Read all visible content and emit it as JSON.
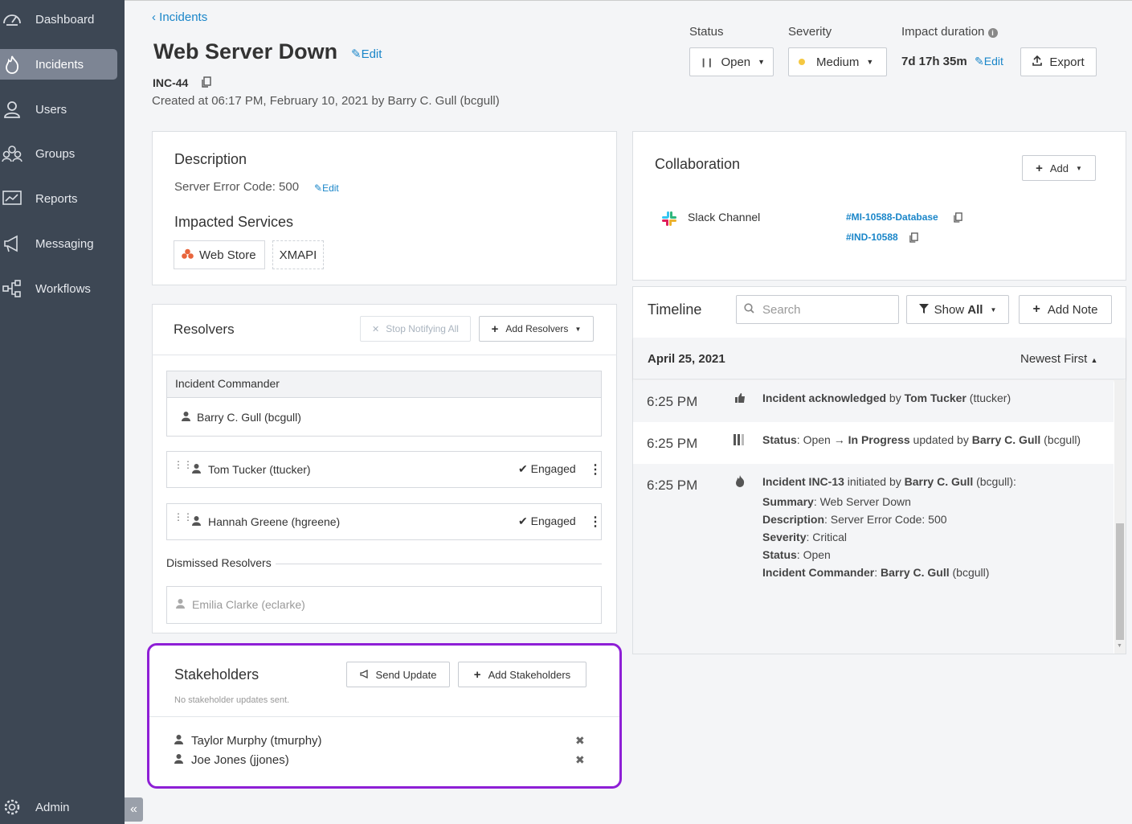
{
  "sidebar": {
    "items": [
      {
        "label": "Dashboard",
        "icon": "gauge-icon"
      },
      {
        "label": "Incidents",
        "icon": "flame-icon"
      },
      {
        "label": "Users",
        "icon": "user-icon"
      },
      {
        "label": "Groups",
        "icon": "groups-icon"
      },
      {
        "label": "Reports",
        "icon": "chart-icon"
      },
      {
        "label": "Messaging",
        "icon": "megaphone-icon"
      },
      {
        "label": "Workflows",
        "icon": "workflow-icon"
      }
    ],
    "admin_label": "Admin",
    "collapse_glyph": "«"
  },
  "header": {
    "breadcrumb": "‹ Incidents",
    "title": "Web Server Down",
    "edit_label": "Edit",
    "incident_id": "INC-44",
    "created": "Created at 06:17 PM, February 10, 2021 by Barry C. Gull (bcgull)",
    "status_label": "Status",
    "status_value": "Open",
    "severity_label": "Severity",
    "severity_value": "Medium",
    "impact_label": "Impact duration",
    "impact_value": "7d 17h 35m",
    "impact_edit": "Edit",
    "export_label": "Export"
  },
  "description": {
    "heading": "Description",
    "text": "Server Error Code: 500",
    "edit_label": "Edit",
    "services_heading": "Impacted Services",
    "services": [
      "Web Store",
      "XMAPI"
    ]
  },
  "resolvers": {
    "heading": "Resolvers",
    "stop_label": "Stop Notifying All",
    "add_label": "Add Resolvers",
    "commander_heading": "Incident Commander",
    "commander": "Barry C. Gull (bcgull)",
    "list": [
      {
        "name": "Tom Tucker (ttucker)",
        "status": "Engaged"
      },
      {
        "name": "Hannah Greene (hgreene)",
        "status": "Engaged"
      }
    ],
    "dismissed_heading": "Dismissed Resolvers",
    "dismissed": [
      "Emilia Clarke (eclarke)"
    ]
  },
  "stakeholders": {
    "heading": "Stakeholders",
    "send_label": "Send Update",
    "add_label": "Add Stakeholders",
    "note": "No stakeholder updates sent.",
    "list": [
      "Taylor Murphy (tmurphy)",
      "Joe Jones (jjones)"
    ]
  },
  "collaboration": {
    "heading": "Collaboration",
    "add_label": "Add",
    "slack_label": "Slack Channel",
    "channels": [
      "#MI-10588-Database",
      "#IND-10588"
    ]
  },
  "timeline": {
    "heading": "Timeline",
    "search_placeholder": "Search",
    "show_label": "Show",
    "show_value": "All",
    "add_note_label": "Add Note",
    "date": "April 25, 2021",
    "sort_label": "Newest First",
    "entries": [
      {
        "time": "6:25 PM",
        "a": "Incident acknowledged",
        "b": " by ",
        "c": "Tom Tucker",
        "d": " (ttucker)"
      },
      {
        "time": "6:25 PM",
        "a": "Status",
        "b": ": Open ",
        "arrow": "→",
        "c": " In Progress",
        "d": " updated by ",
        "e": "Barry C. Gull",
        "f": " (bcgull)"
      },
      {
        "time": "6:25 PM",
        "a": "Incident INC-13",
        "b": " initiated by ",
        "c": "Barry C. Gull",
        "d": " (bcgull)",
        "e": ":"
      }
    ],
    "details": [
      {
        "k": "Summary",
        "v": ": Web Server Down"
      },
      {
        "k": "Description",
        "v": ": Server Error Code: 500"
      },
      {
        "k": "Severity",
        "v": ": Critical"
      },
      {
        "k": "Status",
        "v": ": Open"
      },
      {
        "k": "Incident Commander",
        "v": ": "
      }
    ],
    "detail_commander": "Barry C. Gull",
    "detail_commander_id": " (bcgull)"
  },
  "colors": {
    "highlight": "#8e1fd6",
    "link": "#1a86c9",
    "sidebar": "#3d4754",
    "severity_dot": "#f5c842",
    "web_store": "#e8653c"
  }
}
